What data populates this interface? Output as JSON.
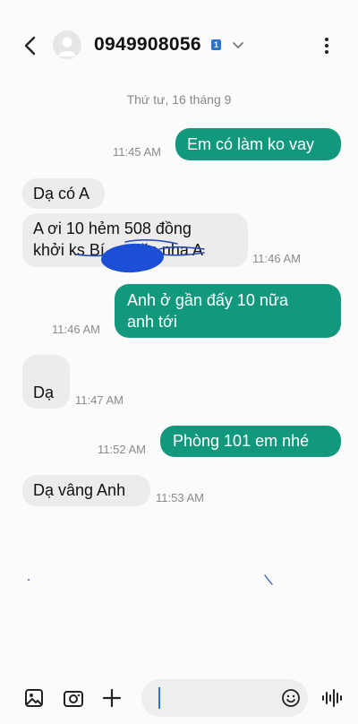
{
  "header": {
    "contact": "0949908056",
    "sim_badge": "1"
  },
  "conversation": {
    "date_separator": "Thứ tư, 16 tháng 9",
    "messages": [
      {
        "direction": "sent",
        "text": "Em có làm ko vay",
        "time": "11:45 AM"
      },
      {
        "direction": "received",
        "text": "Dạ có A",
        "time": ""
      },
      {
        "direction": "received",
        "line1": "A ơi 10 hẻm 508 đồng",
        "line2": "khởi ks Bí        ặc nha A",
        "time": "11:46 AM"
      },
      {
        "direction": "sent",
        "line1": "Anh ở gần đấy 10 nữa",
        "line2": "anh tới",
        "time": "11:46 AM"
      },
      {
        "direction": "received",
        "text": "Dạ",
        "time": "11:47 AM"
      },
      {
        "direction": "sent",
        "text": "Phòng 101 em nhé",
        "time": "11:52 AM"
      },
      {
        "direction": "received",
        "text": "Dạ vâng Anh",
        "time": "11:53 AM"
      }
    ]
  },
  "composer": {
    "icons": [
      "image-icon",
      "camera-icon",
      "plus-icon",
      "emoji-icon",
      "voice-icon"
    ]
  },
  "colors": {
    "sent_bubble": "#12987c",
    "received_bubble": "#ececec",
    "background": "#fbfbfb",
    "redaction": "#1d4fd6"
  }
}
